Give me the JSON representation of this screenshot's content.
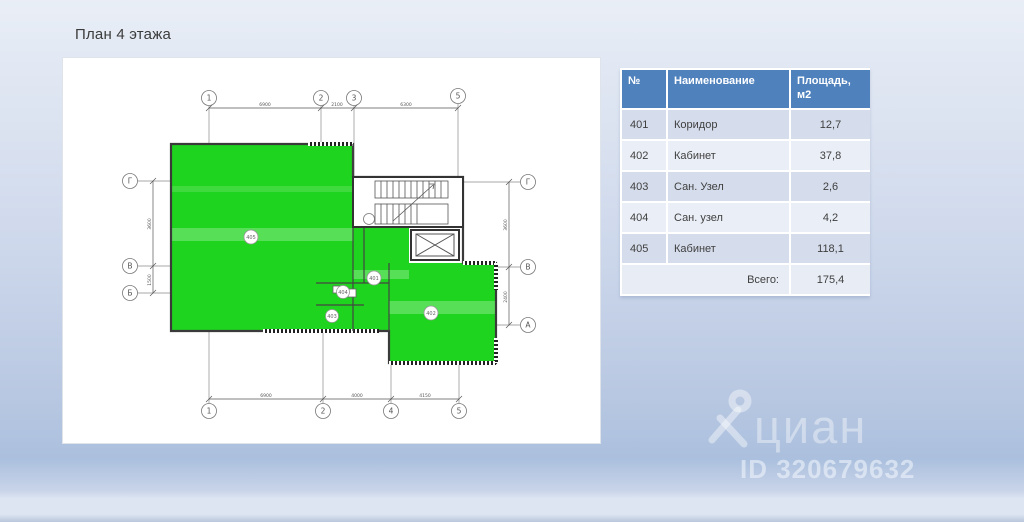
{
  "slide": {
    "title": "План 4 этажа"
  },
  "plan": {
    "axes_top": [
      "1",
      "2",
      "3",
      "5"
    ],
    "axes_bottom": [
      "1",
      "2",
      "4",
      "5"
    ],
    "axes_left": [
      "Г",
      "В",
      "Б"
    ],
    "axes_right": [
      "Г",
      "В",
      "А"
    ],
    "dims_top": [
      "6900",
      "2100",
      "6300"
    ],
    "dims_bottom": [
      "6900",
      "4000",
      "4150"
    ],
    "dims_left": [
      "3600",
      "1500"
    ],
    "dims_right": [
      "3600",
      "2400"
    ],
    "room_labels": {
      "big": "405",
      "corridor": "401",
      "wc_upper": "404",
      "wc_lower": "403",
      "office": "402"
    },
    "highlight_color": "#1fd41f"
  },
  "table": {
    "headers": [
      "№",
      "Наименование",
      "Площадь, м2"
    ],
    "rows": [
      {
        "num": "401",
        "name": "Коридор",
        "area": "12,7"
      },
      {
        "num": "402",
        "name": "Кабинет",
        "area": "37,8"
      },
      {
        "num": "403",
        "name": "Сан. Узел",
        "area": "2,6"
      },
      {
        "num": "404",
        "name": "Сан. узел",
        "area": "4,2"
      },
      {
        "num": "405",
        "name": "Кабинет",
        "area": "118,1"
      }
    ],
    "total_label": "Всего:",
    "total_value": "175,4",
    "header_bg": "#4f81bd"
  },
  "watermark": {
    "brand": "циан",
    "id_label": "ID 320679632"
  }
}
